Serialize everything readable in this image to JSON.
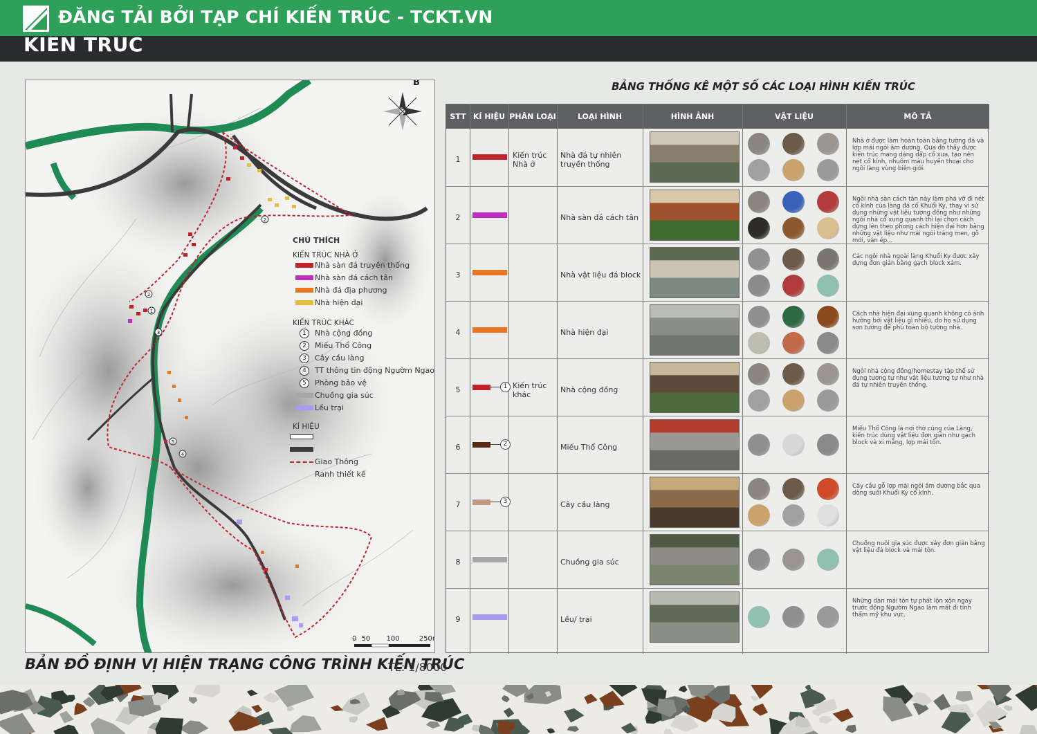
{
  "banner": {
    "text": "ĐĂNG TẢI BỞI TẠP CHÍ KIẾN TRÚC - TCKT.VN",
    "color": "#2ea05a"
  },
  "section_title": "KIẾN TRÚC",
  "map": {
    "title": "BẢN ĐỒ ĐỊNH VỊ HIỆN TRẠNG CÔNG TRÌNH KIẾN TRÚC",
    "scale": "TL: 1/8000",
    "north": "B",
    "scalebar": [
      "0",
      "50",
      "100",
      "250m"
    ],
    "legend": {
      "heading": "CHÚ THÍCH",
      "group1": "KIẾN TRÚC NHÀ Ở",
      "housing": [
        {
          "label": "Nhà sàn đá truyền thống",
          "color": "#c0242b"
        },
        {
          "label": "Nhà sàn đá cách tân",
          "color": "#c12fc1"
        },
        {
          "label": "Nhà đá địa phương",
          "color": "#e87724"
        },
        {
          "label": "Nhà hiện đại",
          "color": "#e3bd3b"
        }
      ],
      "group2": "KIẾN TRÚC KHÁC",
      "other": [
        {
          "num": "1",
          "label": "Nhà cộng đồng"
        },
        {
          "num": "2",
          "label": "Miếu Thổ Công"
        },
        {
          "num": "3",
          "label": "Cây cầu làng"
        },
        {
          "num": "4",
          "label": "TT thông tin động Ngườm Ngao"
        },
        {
          "num": "5",
          "label": "Phòng bảo vệ"
        }
      ],
      "extra": [
        {
          "label": "Chuồng gia súc",
          "color": "#a7a7a7"
        },
        {
          "label": "Lều trại",
          "color": "#a99cf0"
        }
      ],
      "group3": "KÍ HIỆU",
      "symbols": [
        {
          "label": "Giao Thông"
        },
        {
          "label": "Ranh thiết kế"
        }
      ]
    }
  },
  "table": {
    "title": "BẢNG THỐNG KÊ MỘT SỐ CÁC LOẠI HÌNH KIẾN TRÚC",
    "headers": [
      "STT",
      "KÍ HIỆU",
      "PHÂN LOẠI",
      "LOẠI HÌNH",
      "HÌNH ẢNH",
      "VẬT LIỆU",
      "MÔ TẢ"
    ],
    "rows": [
      {
        "stt": "1",
        "color": "#c0242b",
        "num": "",
        "kind": "Kiến trúc Nhà ở",
        "type": "Nhà đá tự nhiên truyền thống",
        "materials": [
          "#8b8580",
          "#6d5b4a",
          "#9b9690",
          "#a0a0a0",
          "#c9a36b",
          "#9a9a9a"
        ],
        "desc": "Nhà ở được làm hoàn toàn bằng tường đá và lợp mái ngói âm dương. Qua đó thấy được kiến trúc mang dáng dấp cổ xưa, tạo nên nét cổ kính, nhuốm màu huyền thoại cho ngôi làng vùng biên giới."
      },
      {
        "stt": "2",
        "color": "#c12fc1",
        "num": "",
        "kind": "",
        "type": "Nhà sàn đá cách tân",
        "materials": [
          "#8b8580",
          "#3a62b8",
          "#b23c3c",
          "#2e2c2a",
          "#8a5a2e",
          "#d8bf90"
        ],
        "desc": "Ngôi nhà sàn cách tân này làm phá vỡ đi nét cổ kính của làng đá cổ Khuổi Ky, thay vì sử dụng những vật liệu tương đồng như những ngôi nhà cổ xung quanh thì lại chọn cách dựng lên theo phong cách hiện đại hơn bằng những vật liệu như mái ngói tráng men, gỗ mới, ván ép..."
      },
      {
        "stt": "3",
        "color": "#e87724",
        "num": "",
        "kind": "",
        "type": "Nhà vật liệu đá block",
        "materials": [
          "#909090",
          "#6d5b4a",
          "#7c7670",
          "#8c8c8c",
          "#b23c3c",
          "#8fc0b0"
        ],
        "desc": "Các ngôi nhà ngoài làng Khuổi Ky được xây dựng đơn giản bằng gạch block xám."
      },
      {
        "stt": "4",
        "color": "#e87724",
        "num": "",
        "kind": "",
        "type": "Nhà hiện đại",
        "materials": [
          "#8f8f8f",
          "#2e6b44",
          "#8a4a1e",
          "#bdbdb0",
          "#c06a4a",
          "#8a8a8a"
        ],
        "desc": "Cách nhà hiện đại xung quanh không có ảnh hưởng bởi vật liệu gì nhiều, do họ sử dụng sơn tường để phủ toàn bộ tường nhà."
      },
      {
        "stt": "5",
        "color": "#c0242b",
        "num": "1",
        "kind": "Kiến trúc khác",
        "type": "Nhà cộng đồng",
        "materials": [
          "#8b8580",
          "#6d5b4a",
          "#9b9690",
          "#a0a0a0",
          "#c9a36b",
          "#9a9a9a"
        ],
        "desc": "Ngôi nhà cộng đồng/homestay tập thể sử dụng tương tự như vật liệu tương tự như nhà đá tự nhiên truyền thống."
      },
      {
        "stt": "6",
        "color": "#5a2a12",
        "num": "2",
        "kind": "",
        "type": "Miếu Thổ Công",
        "materials": [
          "#8f8f8f",
          "#d8d8d8",
          "#8a8a8a"
        ],
        "desc": "Miếu Thổ Công là nơi thờ cúng của Làng, kiến trúc dùng vật liệu đơn giản như gạch block và xi măng, lợp mái tôn."
      },
      {
        "stt": "7",
        "color": "#c49a86",
        "num": "3",
        "kind": "",
        "type": "Cây cầu làng",
        "materials": [
          "#8b8580",
          "#6d5b4a",
          "#d04a2a",
          "#c9a36b",
          "#a0a0a0",
          "#e0e0e0"
        ],
        "desc": "Cây cầu gỗ lợp mái ngói âm dương bắc qua dòng suối Khuổi Ky cổ kính."
      },
      {
        "stt": "8",
        "color": "#a7a7a7",
        "num": "",
        "kind": "",
        "type": "Chuồng gia súc",
        "materials": [
          "#8f8f8f",
          "#9a9590",
          "#8fc0b0"
        ],
        "desc": "Chuồng nuôi gia súc được xây đơn giản bằng vật liệu đá block và mái tôn."
      },
      {
        "stt": "9",
        "color": "#a99cf0",
        "num": "",
        "kind": "",
        "type": "Lều/ trại",
        "materials": [
          "#8fc0b0",
          "#8f8f8f",
          "#9a9a9a"
        ],
        "desc": "Những dàn mái tôn tự phát lộn xộn ngay trước động Ngườm Ngao làm mất đi tính thẩm mỹ khu vực."
      }
    ]
  }
}
